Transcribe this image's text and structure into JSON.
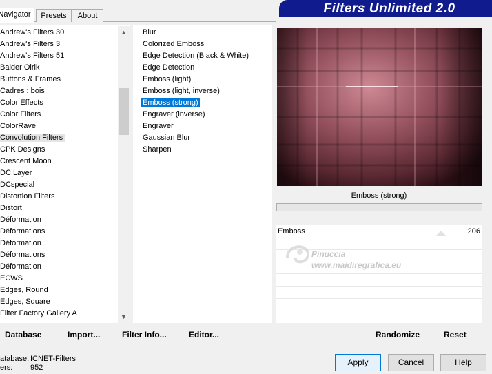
{
  "app": {
    "title": "Filters Unlimited 2.0"
  },
  "tabs": [
    {
      "label": "Navigator"
    },
    {
      "label": "Presets"
    },
    {
      "label": "About"
    }
  ],
  "categories": [
    "Andrew's Filters 30",
    "Andrew's Filters 3",
    "Andrew's Filters 51",
    "Balder Olrik",
    "Buttons & Frames",
    "Cadres : bois",
    "Color Effects",
    "Color Filters",
    "ColorRave",
    "Convolution Filters",
    "CPK Designs",
    "Crescent Moon",
    "DC Layer",
    "DCspecial",
    "Distortion Filters",
    "Distort",
    "Déformation",
    "Déformations",
    "Déformation",
    "Déformations",
    "Déformation",
    "ECWS",
    "Edges, Round",
    "Edges, Square",
    "Filter Factory Gallery A"
  ],
  "selected_category": "Convolution Filters",
  "filters": [
    "Blur",
    "Colorized Emboss",
    "Edge Detection (Black & White)",
    "Edge Detection",
    "Emboss (light)",
    "Emboss (light, inverse)",
    "Emboss (strong)",
    "Engraver (inverse)",
    "Engraver",
    "Gaussian Blur",
    "Sharpen"
  ],
  "selected_filter": "Emboss (strong)",
  "preview": {
    "label": "Emboss (strong)",
    "base_color": "#8a4a55"
  },
  "params": [
    {
      "name": "Emboss",
      "value": "206"
    }
  ],
  "watermark": {
    "line1": "Pinuccia",
    "line2": "www.maidiregrafica.eu"
  },
  "toolbar": {
    "database": "Database",
    "import": "Import...",
    "filter_info": "Filter Info...",
    "editor": "Editor...",
    "randomize": "Randomize",
    "reset": "Reset"
  },
  "status": {
    "database_label": "atabase:",
    "database_value": "ICNET-Filters",
    "filters_label": "ers:",
    "filters_value": "952"
  },
  "buttons": {
    "apply": "Apply",
    "cancel": "Cancel",
    "help": "Help"
  },
  "colors": {
    "selection": "#0078d7",
    "banner": "#101c8e"
  }
}
